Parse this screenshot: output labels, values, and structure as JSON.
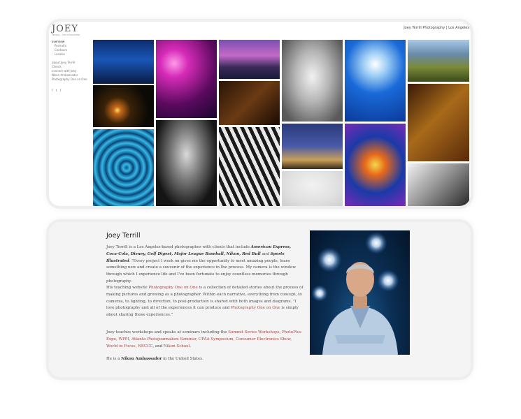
{
  "site": {
    "logo": "JOEY",
    "logo_sub": "TERRILL · PHOTOGRAPHER",
    "title": "Joey Terrill Photography | Los Angeles"
  },
  "nav": [
    {
      "label": "overview",
      "active": true
    },
    {
      "label": "Portraits",
      "sub": true
    },
    {
      "label": "Contours",
      "sub": true
    },
    {
      "label": "Locales",
      "sub": true
    }
  ],
  "nav2": [
    {
      "label": "about Joey Terrill"
    },
    {
      "label": "Clients"
    },
    {
      "label": "connect with Joey"
    },
    {
      "label": "Nikon Ambassador"
    },
    {
      "label": "Photography One on One"
    }
  ],
  "social": [
    "f",
    "t",
    "f"
  ],
  "bio": {
    "title": "Joey Terrill",
    "p1": {
      "a": "Joey Terrill is a Los Angeles-based photographer with clients that include ",
      "b": "American Express, Coca-Cola, Disney, Golf Digest, Major League Baseball, Nikon, Red Bull",
      "c": " and ",
      "d": "Sports Illustrated",
      "e": ". \"Every project I work on gives me the opportunity to meet amazing people, learn something new and create a souvenir of the experience in the process. My camera is the window through which I experience life and I've been fortunate to enjoy countless memories through photography."
    },
    "p2": {
      "a": "His teaching website ",
      "b": "Photography One on One",
      "c": " is a collection of detailed stories about the process of making pictures and growing as a photographer. Within each narrative, everything from concept, to cameras, to lighting, to direction, to post-production is shared with both images and diagrams. \"I love photography and all of the experiences it can produce and ",
      "d": "Photography One on One",
      "e": " is simply about sharing those experiences.\""
    },
    "p3": {
      "a": "Joey teaches workshops and speaks at seminars including the ",
      "b": "Summit Series Workshops, PhotoPlus Expo, WPPI, Atlanta Photojournalism Seminar, UPAA Symposium, Consumer Electronics Show, World in Focus, NECCC",
      "c": ", and ",
      "d": "Nikon School",
      "e": "."
    },
    "p4": {
      "a": "He is a ",
      "b": "Nikon Ambassador",
      "c": " in the United States."
    }
  },
  "colors": {
    "link": "#a44848",
    "card_bg": "#f4f4f4",
    "text": "#4a4a4a"
  },
  "tiles": [
    {
      "name": "photo-night-window",
      "bg": "linear-gradient(180deg,#0d2c6b 0%,#1a56b8 45%,#0a1c44 100%)"
    },
    {
      "name": "photo-moonrise",
      "bg": "radial-gradient(circle at 40% 60%,#ffdd66 0%,#c76a1a 8%,#3a2208 30%,#0b0a06 70%)"
    },
    {
      "name": "photo-blue-spiral",
      "bg": "repeating-radial-gradient(circle at 55% 50%,#0a5a8a 0px,#35b8e8 5px,#0a3a6a 10px)"
    },
    {
      "name": "photo-pink-droplets",
      "bg": "radial-gradient(circle at 30% 30%,#ff9ae8 0%,#d62bb8 20%,#5a0a5e 60%,#1a0530 100%)"
    },
    {
      "name": "photo-baseball-player",
      "bg": "radial-gradient(ellipse at 50% 40%,#d9d9d9 0%,#7a7a7a 35%,#141414 75%)"
    },
    {
      "name": "photo-bay-dusk",
      "bg": "linear-gradient(180deg,#7a4fb0 0%,#c46ac8 40%,#3a2a5a 70%,#1a1a3a 100%)"
    },
    {
      "name": "photo-window-figure",
      "bg": "linear-gradient(135deg,#2a1406 0%,#6a3a14 50%,#1a0a04 100%)"
    },
    {
      "name": "photo-zebra-model",
      "bg": "repeating-linear-gradient(65deg,#e8e8e8 0px,#e8e8e8 5px,#1a1a1a 5px,#1a1a1a 10px)"
    },
    {
      "name": "photo-bride",
      "bg": "radial-gradient(ellipse at 50% 45%,#f2f2f2 0%,#b5b5b5 40%,#5a5a5a 85%)"
    },
    {
      "name": "photo-modern-house",
      "bg": "linear-gradient(180deg,#2a3a7a 0%,#4a5aa8 50%,#c8a05a 80%,#3a2a1a 100%)"
    },
    {
      "name": "photo-boy-portrait",
      "bg": "radial-gradient(ellipse at 50% 40%,#f2f2f2 0%,#e0e0e0 60%,#cfcfcf 100%)"
    },
    {
      "name": "photo-dandelion",
      "bg": "radial-gradient(circle at 50% 30%,#ffffff 0%,#9fcff5 18%,#1a6ad8 45%,#0a3a9a 100%)"
    },
    {
      "name": "photo-color-bubbles",
      "bg": "radial-gradient(circle at 50% 50%,#f2d84a 0%,#e86a1a 20%,#1a3aa8 55%,#7a2ab8 100%)"
    },
    {
      "name": "photo-coastline",
      "bg": "linear-gradient(180deg,#a8c8e8 0%,#6a8aa8 35%,#7a8a3a 65%,#3a4a1a 100%)"
    },
    {
      "name": "photo-brown-leaf",
      "bg": "linear-gradient(135deg,#3a1a06 0%,#a86a1a 45%,#5a2a0a 100%)"
    },
    {
      "name": "photo-architecture",
      "bg": "linear-gradient(135deg,#f2f2f2 0%,#9a9a9a 45%,#2a2a2a 100%)"
    }
  ],
  "portrait": {
    "name": "photo-joey-terrill-portrait"
  }
}
